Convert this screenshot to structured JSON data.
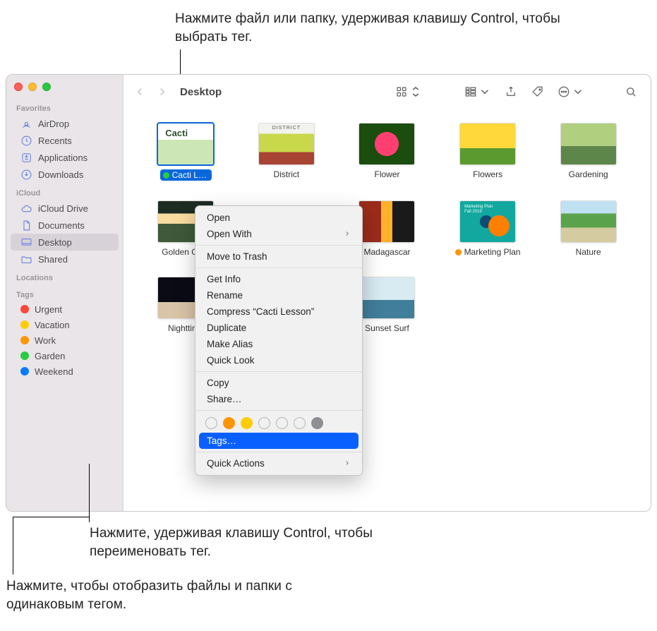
{
  "callouts": {
    "top": "Нажмите файл или папку, удерживая клавишу Control, чтобы выбрать тег.",
    "mid": "Нажмите, удерживая клавишу Control, чтобы переименовать тег.",
    "bot": "Нажмите, чтобы отобразить файлы и папки с одинаковым тегом."
  },
  "window": {
    "title": "Desktop"
  },
  "sidebar": {
    "sections": {
      "favorites": {
        "header": "Favorites",
        "items": [
          "AirDrop",
          "Recents",
          "Applications",
          "Downloads"
        ]
      },
      "icloud": {
        "header": "iCloud",
        "items": [
          "iCloud Drive",
          "Documents",
          "Desktop",
          "Shared"
        ],
        "selected": "Desktop"
      },
      "locations": {
        "header": "Locations"
      },
      "tags": {
        "header": "Tags",
        "items": [
          {
            "label": "Urgent",
            "color": "red"
          },
          {
            "label": "Vacation",
            "color": "yellow"
          },
          {
            "label": "Work",
            "color": "orange"
          },
          {
            "label": "Garden",
            "color": "green"
          },
          {
            "label": "Weekend",
            "color": "blue"
          }
        ]
      }
    }
  },
  "files": [
    {
      "name": "Cacti Lesson",
      "thumb": "cacti",
      "selected": true,
      "tag": "green"
    },
    {
      "name": "District",
      "thumb": "district"
    },
    {
      "name": "Flower",
      "thumb": "flower"
    },
    {
      "name": "Flowers",
      "thumb": "flowers"
    },
    {
      "name": "Gardening",
      "thumb": "garden"
    },
    {
      "name": "Golden Gate",
      "thumb": "golden"
    },
    {
      "name": "Madagascar",
      "thumb": "mada"
    },
    {
      "name": "Marketing Plan",
      "thumb": "market",
      "tag": "orange"
    },
    {
      "name": "Nature",
      "thumb": "nature"
    },
    {
      "name": "Nighttime",
      "thumb": "night"
    },
    {
      "name": "Sunset Surf",
      "thumb": "sunset"
    }
  ],
  "context_menu": {
    "groups": [
      [
        "Open",
        "Open With"
      ],
      [
        "Move to Trash"
      ],
      [
        "Get Info",
        "Rename",
        "Compress “Cacti Lesson”",
        "Duplicate",
        "Make Alias",
        "Quick Look"
      ],
      [
        "Copy",
        "Share…"
      ]
    ],
    "tags_label": "Tags…",
    "quick_actions": "Quick Actions",
    "submenu_items": [
      "Open With",
      "Quick Actions"
    ]
  }
}
